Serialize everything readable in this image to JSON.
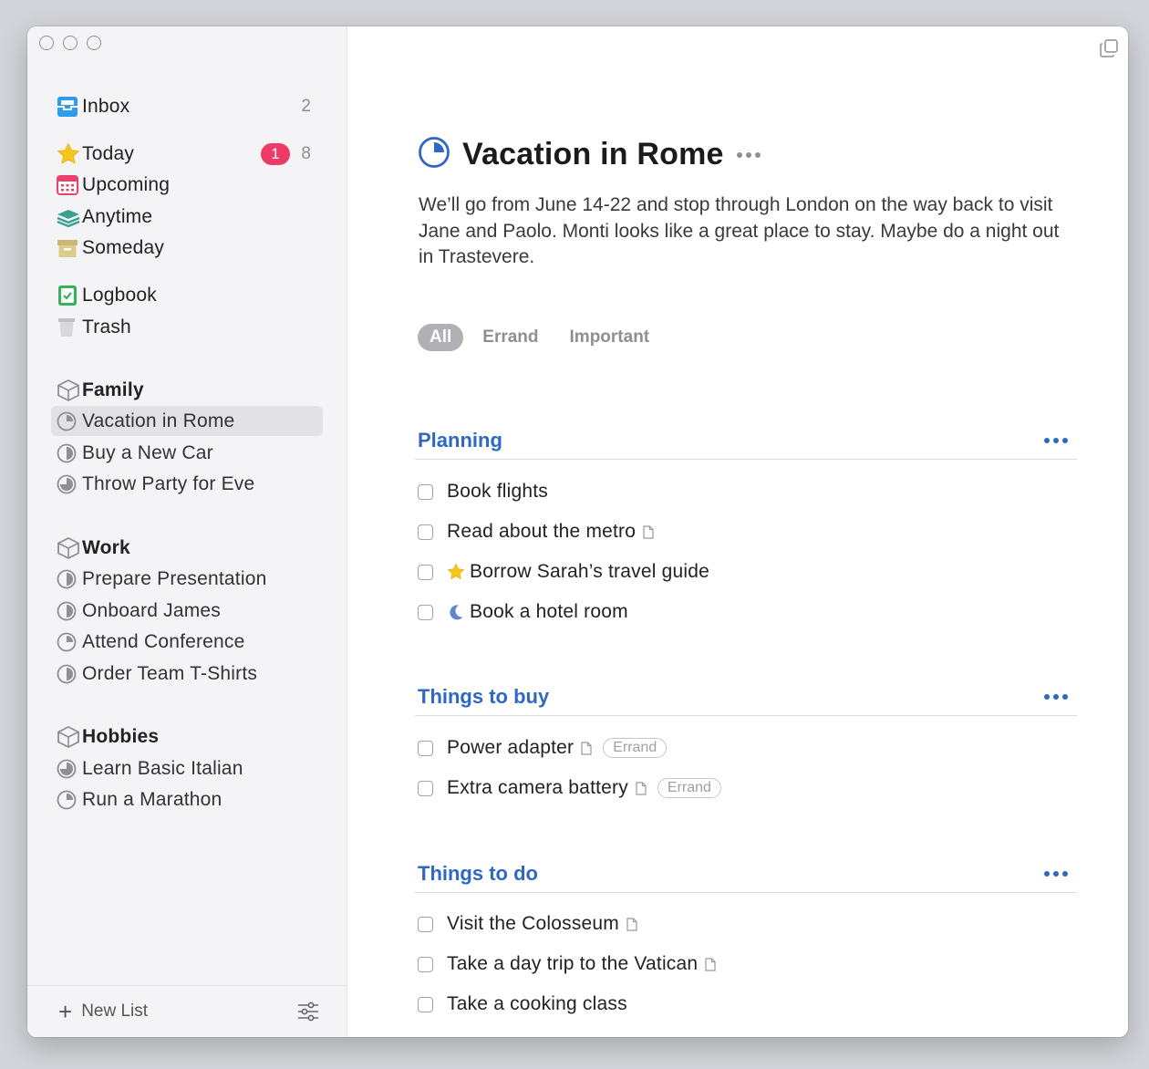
{
  "sidebar": {
    "inbox": {
      "label": "Inbox",
      "count": "2",
      "icon": "inbox-icon"
    },
    "smart_lists": [
      {
        "label": "Today",
        "badge": "1",
        "count": "8",
        "icon": "star-icon"
      },
      {
        "label": "Upcoming",
        "icon": "calendar-icon"
      },
      {
        "label": "Anytime",
        "icon": "layers-icon"
      },
      {
        "label": "Someday",
        "icon": "archive-box-icon"
      }
    ],
    "logbook": {
      "label": "Logbook",
      "icon": "logbook-check-icon"
    },
    "trash": {
      "label": "Trash",
      "icon": "trash-icon"
    },
    "areas": [
      {
        "label": "Family",
        "projects": [
          "Vacation in Rome",
          "Buy a New Car",
          "Throw Party for Eve"
        ]
      },
      {
        "label": "Work",
        "projects": [
          "Prepare Presentation",
          "Onboard James",
          "Attend Conference",
          "Order Team T-Shirts"
        ]
      },
      {
        "label": "Hobbies",
        "projects": [
          "Learn Basic Italian",
          "Run a Marathon"
        ]
      }
    ],
    "selected_project": "Vacation in Rome",
    "footer": {
      "new_list_label": "New List"
    }
  },
  "main": {
    "title": "Vacation in Rome",
    "notes": "We’ll go from June 14-22 and stop through London on the way back to visit Jane and Paolo. Monti looks like a great place to stay. Maybe do a night out in Trastevere.",
    "tag_filters": [
      "All",
      "Errand",
      "Important"
    ],
    "active_tag": "All",
    "sections": [
      {
        "title": "Planning",
        "todos": [
          {
            "text": "Book flights"
          },
          {
            "text": "Read about the metro",
            "has_note": true
          },
          {
            "text": "Borrow Sarah’s travel guide",
            "prefix_icon": "star-icon"
          },
          {
            "text": "Book a hotel room",
            "prefix_icon": "moon-icon"
          }
        ]
      },
      {
        "title": "Things to buy",
        "todos": [
          {
            "text": "Power adapter",
            "has_note": true,
            "tag": "Errand"
          },
          {
            "text": "Extra camera battery",
            "has_note": true,
            "tag": "Errand"
          }
        ]
      },
      {
        "title": "Things to do",
        "todos": [
          {
            "text": "Visit the Colosseum",
            "has_note": true
          },
          {
            "text": "Take a day trip to the Vatican",
            "has_note": true
          },
          {
            "text": "Take a cooking class"
          }
        ]
      }
    ]
  },
  "colors": {
    "accent_blue": "#2f67c4",
    "badge_red": "#ee3a67",
    "sidebar_bg": "#f4f4f6",
    "selected_bg": "#e2e2e6"
  }
}
